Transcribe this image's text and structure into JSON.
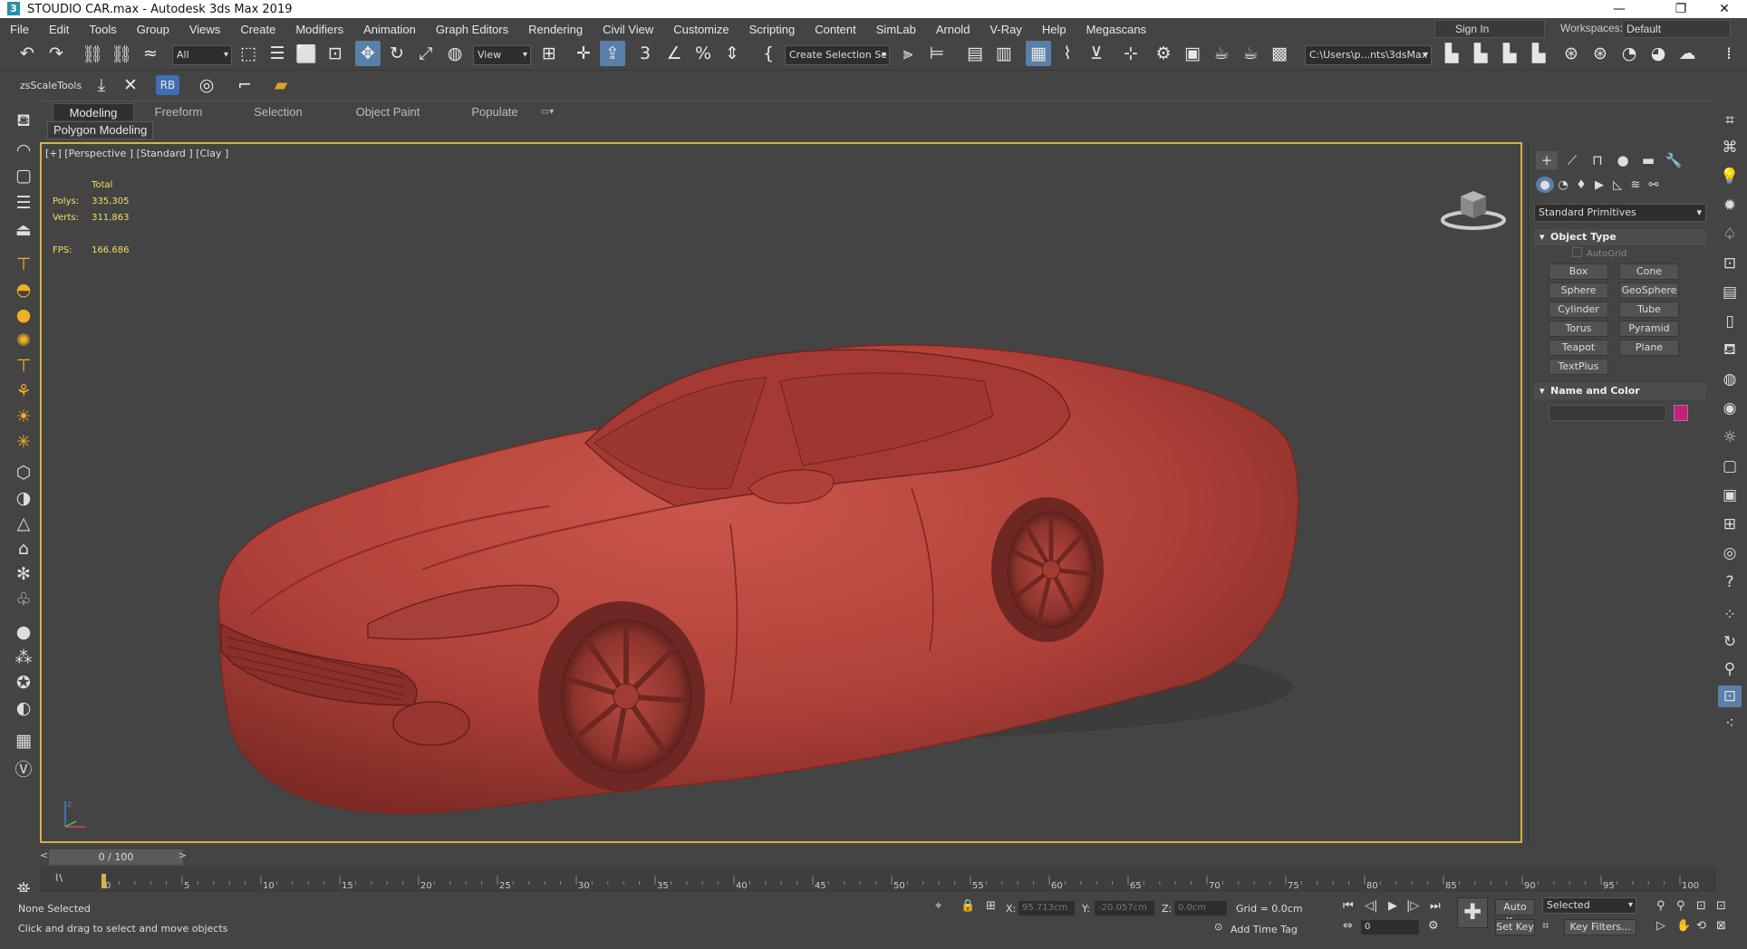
{
  "window": {
    "title": "STOUDIO  CAR.max - Autodesk 3ds Max 2019",
    "logo": "3",
    "minimize": "—",
    "restore": "❐",
    "close": "✕"
  },
  "menu": [
    "File",
    "Edit",
    "Tools",
    "Group",
    "Views",
    "Create",
    "Modifiers",
    "Animation",
    "Graph Editors",
    "Rendering",
    "Civil View",
    "Customize",
    "Scripting",
    "Content",
    "SimLab",
    "Arnold",
    "V-Ray",
    "Help",
    "Megascans"
  ],
  "account": {
    "signin": "Sign In",
    "workspace_label": "Workspaces:",
    "workspace_value": "Default"
  },
  "toolbar": {
    "selection_filter": "All",
    "ref_coord": "View",
    "selection_set": "Create Selection Se",
    "project_path": "C:\\Users\\p...nts\\3dsMax",
    "zs_label": "zsScaleTools",
    "rb_label": "RB"
  },
  "ribbon": {
    "tabs": [
      "Modeling",
      "Freeform",
      "Selection",
      "Object Paint",
      "Populate"
    ],
    "active_tab": "Modeling",
    "sub_tab": "Polygon Modeling"
  },
  "viewport": {
    "label": "[+] [Perspective ] [Standard ] [Clay ]",
    "stats": {
      "total_label": "Total",
      "polys_label": "Polys:",
      "polys": "335,305",
      "verts_label": "Verts:",
      "verts": "311,863",
      "fps_label": "FPS:",
      "fps": "166.686"
    },
    "axis_label": "z"
  },
  "command_panel": {
    "category": "Standard Primitives",
    "object_type_title": "Object Type",
    "autogrid": "AutoGrid",
    "primitives": [
      "Box",
      "Cone",
      "Sphere",
      "GeoSphere",
      "Cylinder",
      "Tube",
      "Torus",
      "Pyramid",
      "Teapot",
      "Plane",
      "TextPlus"
    ],
    "name_color_title": "Name and Color",
    "object_color": "#c81e7c"
  },
  "timeline": {
    "frame_display": "0 / 100",
    "prev": "<",
    "next": ">",
    "ticks": [
      "0",
      "5",
      "10",
      "15",
      "20",
      "25",
      "30",
      "35",
      "40",
      "45",
      "50",
      "55",
      "60",
      "65",
      "70",
      "75",
      "80",
      "85",
      "90",
      "95",
      "100"
    ]
  },
  "status": {
    "selection": "None Selected",
    "prompt": "Click and drag to select and move objects",
    "x_label": "X:",
    "x": "95.713cm",
    "y_label": "Y:",
    "y": "-20.057cm",
    "z_label": "Z:",
    "z": "0.0cm",
    "grid": "Grid = 0.0cm",
    "add_time_tag": "Add Time Tag",
    "auto_key": "Auto Key",
    "set_key": "Set Key",
    "key_mode": "Selected",
    "key_filters": "Key Filters...",
    "frame_spinner": "0"
  },
  "colors": {
    "accent": "#5a7fa8",
    "viewport_border": "#d6b24a",
    "car_clay": "#b8453c",
    "stats_text": "#f0e060"
  }
}
